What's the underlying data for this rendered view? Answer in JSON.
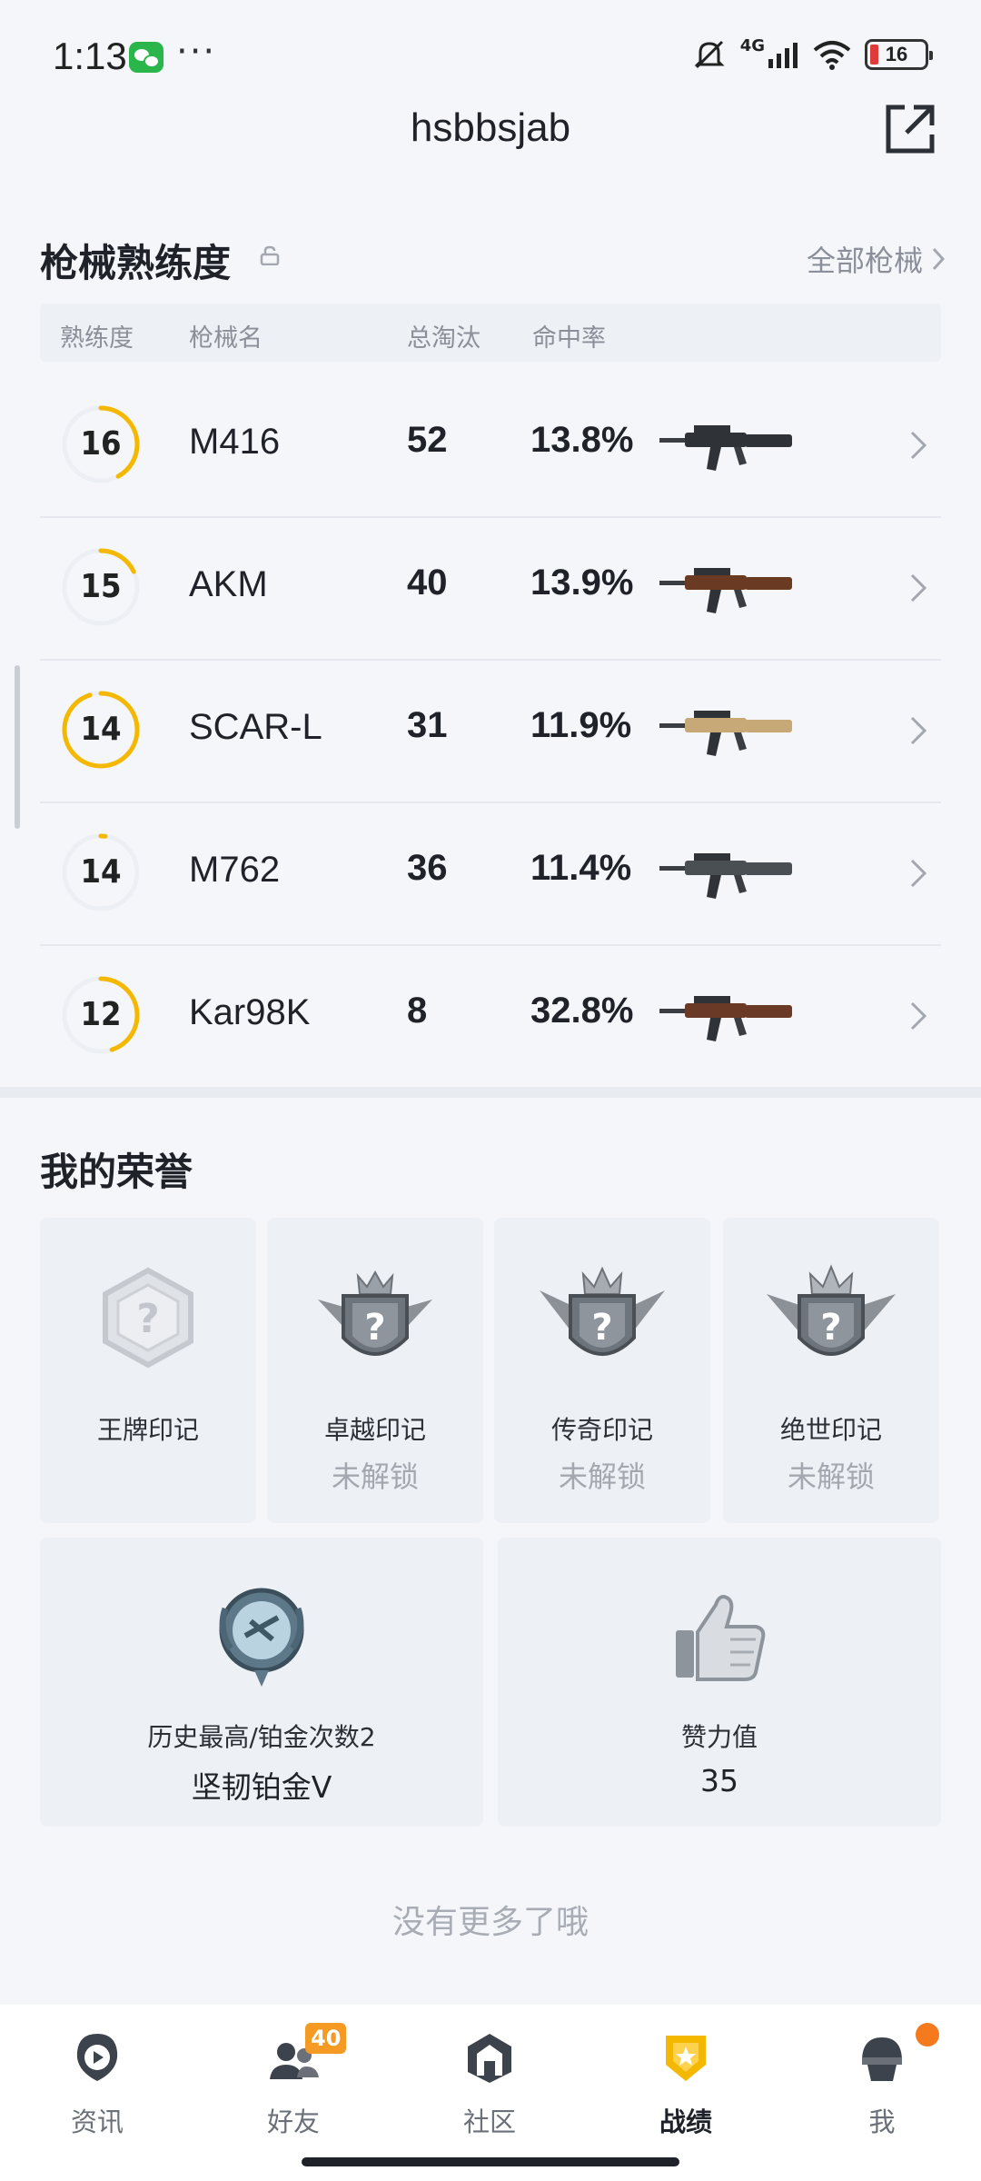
{
  "status_bar": {
    "time": "1:13",
    "network": "4G",
    "battery": "16"
  },
  "header": {
    "title": "hsbbsjab"
  },
  "weapons": {
    "title": "枪械熟练度",
    "all_link": "全部枪械",
    "columns": [
      "熟练度",
      "枪械名",
      "总淘汰",
      "命中率"
    ],
    "rows": [
      {
        "level": "16",
        "progress": 0.42,
        "name": "M416",
        "kills": "52",
        "hit_rate": "13.8%"
      },
      {
        "level": "15",
        "progress": 0.18,
        "name": "AKM",
        "kills": "40",
        "hit_rate": "13.9%"
      },
      {
        "level": "14",
        "progress": 0.95,
        "name": "SCAR-L",
        "kills": "31",
        "hit_rate": "11.9%"
      },
      {
        "level": "14",
        "progress": 0.02,
        "name": "M762",
        "kills": "36",
        "hit_rate": "11.4%"
      },
      {
        "level": "12",
        "progress": 0.45,
        "name": "Kar98K",
        "kills": "8",
        "hit_rate": "32.8%"
      }
    ]
  },
  "honors": {
    "title": "我的荣誉",
    "badges": [
      {
        "name": "王牌印记",
        "status": ""
      },
      {
        "name": "卓越印记",
        "status": "未解锁"
      },
      {
        "name": "传奇印记",
        "status": "未解锁"
      },
      {
        "name": "绝世印记",
        "status": "未解锁"
      }
    ],
    "rank": {
      "label": "历史最高/铂金次数2",
      "value": "坚韧铂金V"
    },
    "likes": {
      "label": "赞力值",
      "value": "35"
    }
  },
  "footer_text": "没有更多了哦",
  "bottom_nav": {
    "items": [
      {
        "label": "资讯",
        "icon": "news-icon"
      },
      {
        "label": "好友",
        "icon": "friends-icon",
        "badge": "40"
      },
      {
        "label": "社区",
        "icon": "community-icon"
      },
      {
        "label": "战绩",
        "icon": "records-icon"
      },
      {
        "label": "我",
        "icon": "profile-icon"
      }
    ],
    "active": "战绩"
  },
  "colors": {
    "accent": "#f5b800",
    "ring_track": "#eceff3",
    "badge_orange": "#f59a23"
  }
}
